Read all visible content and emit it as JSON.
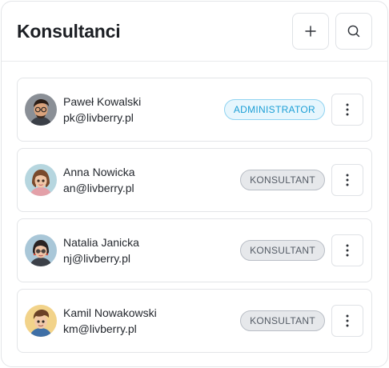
{
  "header": {
    "title": "Konsultanci",
    "add_icon": "plus-icon",
    "search_icon": "search-icon"
  },
  "consultants": [
    {
      "name": "Paweł Kowalski",
      "email": "pk@livberry.pl",
      "role": "ADMINISTRATOR",
      "role_type": "admin"
    },
    {
      "name": "Anna Nowicka",
      "email": "an@livberry.pl",
      "role": "KONSULTANT",
      "role_type": "consultant"
    },
    {
      "name": "Natalia Janicka",
      "email": "nj@livberry.pl",
      "role": "KONSULTANT",
      "role_type": "consultant"
    },
    {
      "name": "Kamil Nowakowski",
      "email": "km@livberry.pl",
      "role": "KONSULTANT",
      "role_type": "consultant"
    }
  ],
  "colors": {
    "admin_badge_text": "#1c9fd6",
    "admin_badge_bg": "#e7f6fd",
    "consultant_badge_text": "#555c66",
    "consultant_badge_bg": "#e6e8eb"
  }
}
